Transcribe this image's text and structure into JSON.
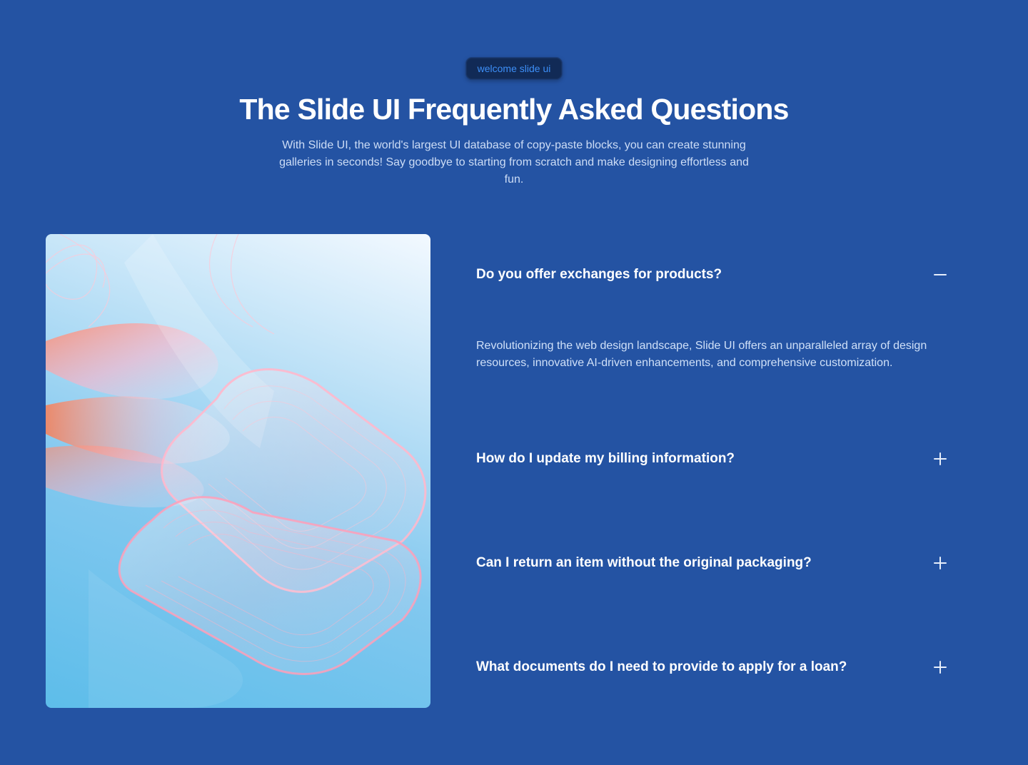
{
  "header": {
    "badge": "welcome slide ui",
    "title": "The Slide UI Frequently Asked Questions",
    "description": "With Slide UI, the world's largest UI database of copy-paste blocks, you can create stunning galleries in seconds! Say goodbye to starting from scratch and make designing effortless and fun."
  },
  "faq": {
    "items": [
      {
        "question": "Do you offer exchanges for products?",
        "answer": "Revolutionizing the web design landscape, Slide UI offers an unparalleled array of design resources, innovative AI-driven enhancements, and comprehensive customization.",
        "expanded": true,
        "toggle_icon": "minus-icon"
      },
      {
        "question": "How do I update my billing information?",
        "expanded": false,
        "toggle_icon": "plus-icon"
      },
      {
        "question": "Can I return an item without the original packaging?",
        "expanded": false,
        "toggle_icon": "plus-icon"
      },
      {
        "question": "What documents do I need to provide to apply for a loan?",
        "expanded": false,
        "toggle_icon": "plus-icon"
      }
    ]
  },
  "theme": {
    "background": "#2453a3",
    "badge_text": "#3d8ff7",
    "badge_background": "#112a56"
  }
}
